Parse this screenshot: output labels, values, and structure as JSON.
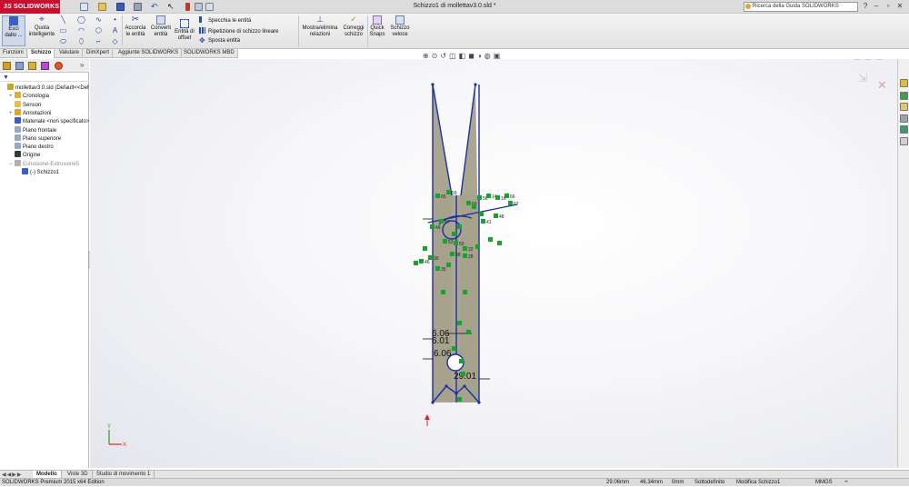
{
  "app": {
    "brand": "SOLIDWORKS",
    "brand_prefix": "3S",
    "document_title": "Schizzo1 di mollettav3.0.sld *"
  },
  "title_bar": {
    "help_search_placeholder": "Ricerca della Guida SOLIDWORKS",
    "window_buttons": [
      "?",
      "–",
      "▫",
      "✕"
    ]
  },
  "command_manager": {
    "exit_sketch": "Esci dallo ...",
    "smart_dimension": "Quota intelligente",
    "trim": "Accorcia le entità",
    "convert": "Converti entità",
    "offset": "Entità di offset",
    "mirror": "Specchia le entità",
    "linear_pattern": "Ripetizione di schizzo lineare",
    "move": "Sposta entità",
    "relations": "Mostra/elimina relazioni",
    "repair": "Correggi schizzo",
    "quick_snaps": "Quick Snaps",
    "rapid_sketch": "Schizzo veloce"
  },
  "tabs": [
    "Funzioni",
    "Schizzo",
    "Valutare",
    "DimXpert",
    "Aggiunte SOLIDWORKS",
    "SOLIDWORKS MBD"
  ],
  "active_tab": "Schizzo",
  "feature_tree": [
    {
      "label": "mollettav3.0.sld  (Default<<Def",
      "icon": "part-icon",
      "color": "#c8a52a",
      "indent": 0,
      "expander": ""
    },
    {
      "label": "Cronologia",
      "icon": "history-icon",
      "color": "#d8b040",
      "indent": 1,
      "expander": "+"
    },
    {
      "label": "Sensori",
      "icon": "sensor-icon",
      "color": "#e0c050",
      "indent": 1,
      "expander": ""
    },
    {
      "label": "Annotazioni",
      "icon": "annotation-icon",
      "color": "#d8a830",
      "indent": 1,
      "expander": "+"
    },
    {
      "label": "Materiale <non specificato>",
      "icon": "material-icon",
      "color": "#3a5fc0",
      "indent": 1,
      "expander": ""
    },
    {
      "label": "Piano frontale",
      "icon": "plane-icon",
      "color": "#9aa8c0",
      "indent": 1,
      "expander": ""
    },
    {
      "label": "Piano superiore",
      "icon": "plane-icon",
      "color": "#9aa8c0",
      "indent": 1,
      "expander": ""
    },
    {
      "label": "Piano destro",
      "icon": "plane-icon",
      "color": "#9aa8c0",
      "indent": 1,
      "expander": ""
    },
    {
      "label": "Origine",
      "icon": "origin-icon",
      "color": "#3a3a3a",
      "indent": 1,
      "expander": ""
    },
    {
      "label": "Estrusione-Estrusione5",
      "icon": "extrude-icon",
      "color": "#b0b0b0",
      "indent": 1,
      "expander": "−"
    },
    {
      "label": "(-) Schizzo1",
      "icon": "sketch-icon",
      "color": "#3a5fc0",
      "indent": 2,
      "expander": ""
    }
  ],
  "bottom_tabs": [
    "Modello",
    "Viste 3D",
    "Studio di movimento 1"
  ],
  "active_bottom_tab": "Modello",
  "status_bar": {
    "edition": "SOLIDWORKS Premium 2015 x64 Edition",
    "x": "29.06mm",
    "y": "46.34mm",
    "z": "0mm",
    "definition": "Sottodefinito",
    "mode": "Modifica Schizzo1",
    "units": "MMGS"
  },
  "sketch": {
    "dimensions": [
      "6.06",
      "6.01",
      "6.06",
      "29.01"
    ],
    "relation_labels": [
      "65",
      "59",
      "60",
      "56",
      "14",
      "16",
      "66",
      "67",
      "48",
      "41",
      "47",
      "49",
      "53",
      "50",
      "32",
      "38",
      "39",
      "46",
      "35",
      "28"
    ],
    "colors": {
      "outline": "#1c2fa8",
      "fill": "#a7a18c",
      "relation": "#14a52a",
      "vertex": "#1c2fa8"
    }
  }
}
